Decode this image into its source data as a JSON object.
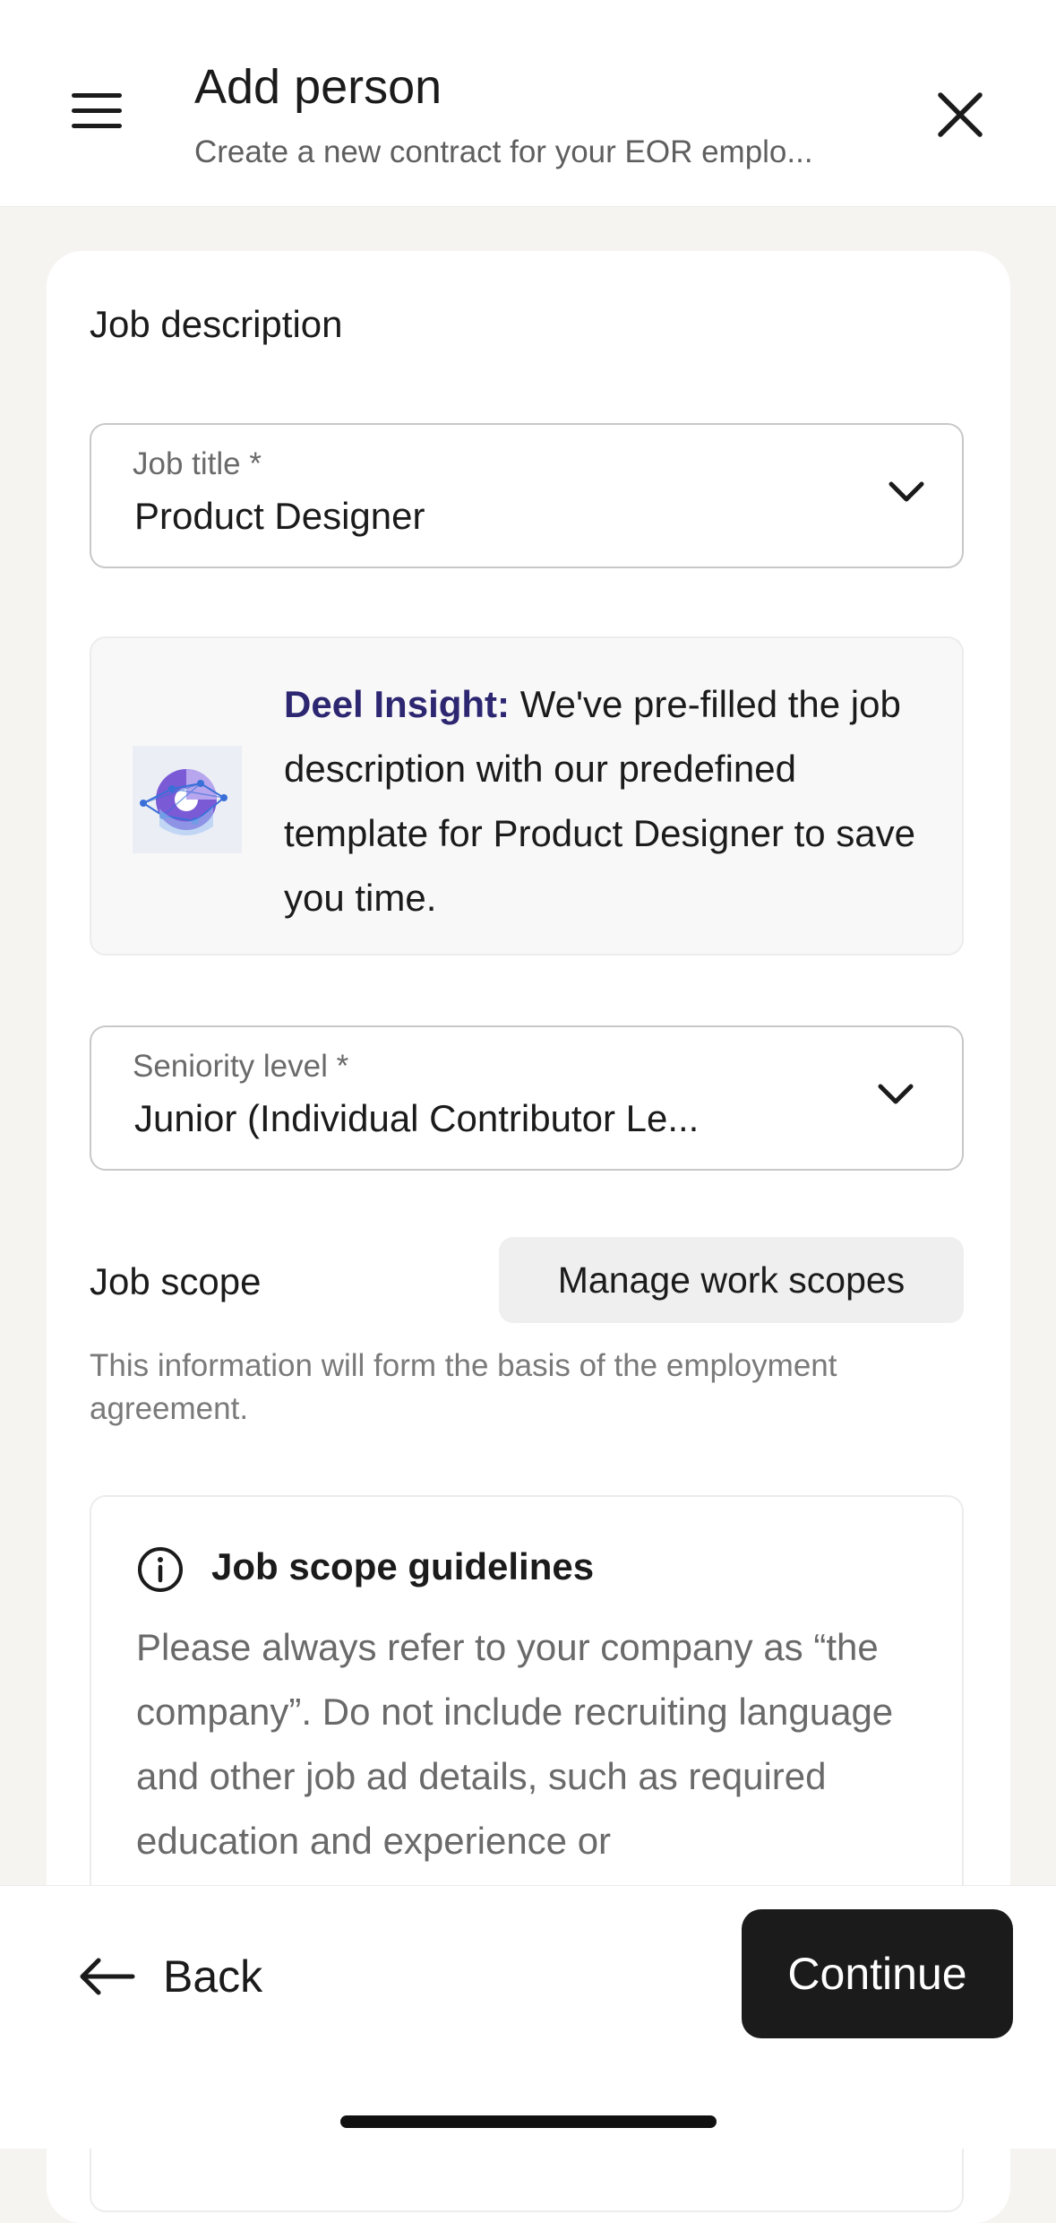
{
  "header": {
    "title": "Add person",
    "subtitle": "Create a new contract for your EOR emplo..."
  },
  "job_description": {
    "section_title": "Job description",
    "job_title": {
      "label": "Job title *",
      "value": "Product Designer"
    },
    "insight": {
      "brand": "Deel Insight:",
      "message": " We've pre-filled the job description with our predefined template for Product Designer to save you time."
    },
    "seniority": {
      "label": "Seniority level *",
      "value": "Junior (Individual Contributor Le..."
    }
  },
  "job_scope": {
    "title": "Job scope",
    "manage_button": "Manage work scopes",
    "help_text": "This information will form the basis of the employment agreement.",
    "guidelines": {
      "title": "Job scope guidelines",
      "body": "Please always refer to your company as “the company”. Do not include recruiting language and other job ad details, such as required education and experience or"
    }
  },
  "footer": {
    "back_label": "Back",
    "continue_label": "Continue"
  },
  "icons": {
    "menu": "hamburger-menu-icon",
    "close": "close-icon",
    "chevron": "chevron-down-icon",
    "info": "info-icon",
    "back": "arrow-left-icon"
  },
  "colors": {
    "brand_insight": "#2d2772",
    "primary_button": "#1b1b1b",
    "page_background": "#f5f4f1"
  }
}
